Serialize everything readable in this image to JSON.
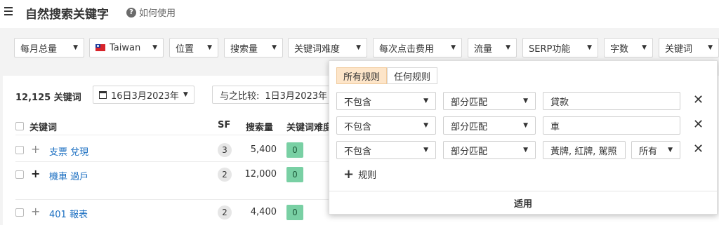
{
  "header": {
    "title": "自然搜索关键字",
    "help_label": "如何使用"
  },
  "filters": {
    "monthly": "每月总量",
    "country": "Taiwan",
    "position": "位置",
    "volume": "搜索量",
    "kd": "关键词难度",
    "cpc": "每次点击费用",
    "traffic": "流量",
    "serp": "SERP功能",
    "words": "字数",
    "keywords": "关键词"
  },
  "toolbar": {
    "count_label": "12,125 关键词",
    "date_label": "16日3月2023年",
    "compare_label": "与之比较:",
    "compare_date": "1日3月2023年"
  },
  "table": {
    "headers": {
      "keyword": "关键词",
      "sf": "SF",
      "volume": "搜索量",
      "kd": "关键词难度"
    },
    "rows": [
      {
        "keyword": "支票 兌現",
        "sf": "3",
        "volume": "5,400",
        "kd": "0"
      },
      {
        "keyword": "機車 過戶",
        "sf": "2",
        "volume": "12,000",
        "kd": "0"
      },
      {
        "keyword": "401 報表",
        "sf": "2",
        "volume": "4,400",
        "kd": "0"
      }
    ]
  },
  "popup": {
    "tab_all": "所有规则",
    "tab_any": "任何规则",
    "rules": [
      {
        "condition": "不包含",
        "match": "部分匹配",
        "value": "貸款"
      },
      {
        "condition": "不包含",
        "match": "部分匹配",
        "value": "車"
      },
      {
        "condition": "不包含",
        "match": "部分匹配",
        "value": "黃牌, 紅牌, 駕照",
        "scope": "所有"
      }
    ],
    "add_rule": "规则",
    "apply": "适用"
  },
  "colors": {
    "accent_tab": "#fde5c9",
    "kd_green": "#79d0a4",
    "link": "#1a6ec1"
  }
}
